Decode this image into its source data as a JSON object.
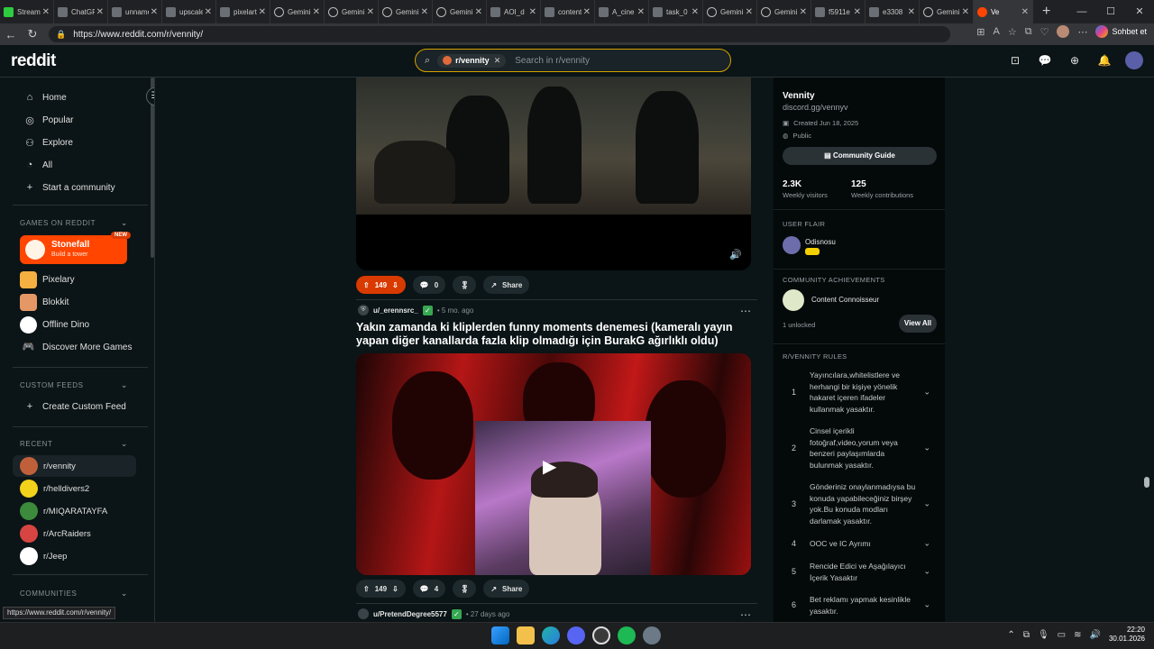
{
  "browser": {
    "tabs": [
      {
        "label": "Stream"
      },
      {
        "label": "ChatGPT"
      },
      {
        "label": "unname"
      },
      {
        "label": "upscale"
      },
      {
        "label": "pixelart"
      },
      {
        "label": "Gemini"
      },
      {
        "label": "Gemini"
      },
      {
        "label": "Gemini"
      },
      {
        "label": "Gemini"
      },
      {
        "label": "AOI_d"
      },
      {
        "label": "content"
      },
      {
        "label": "A_cine"
      },
      {
        "label": "task_0"
      },
      {
        "label": "Gemini"
      },
      {
        "label": "Gemini"
      },
      {
        "label": "f5911e"
      },
      {
        "label": "e3308"
      },
      {
        "label": "Gemini"
      },
      {
        "label": "Ve"
      }
    ],
    "url": "https://www.reddit.com/r/vennity/",
    "copilot_label": "Sohbet et"
  },
  "header": {
    "logo": "reddit",
    "search_chip": "r/vennity",
    "search_placeholder": "Search in r/vennity"
  },
  "left_sidebar": {
    "nav": [
      {
        "label": "Home",
        "icon": "home-icon",
        "glyph": "⌂"
      },
      {
        "label": "Popular",
        "icon": "popular-icon",
        "glyph": "◎"
      },
      {
        "label": "Explore",
        "icon": "explore-icon",
        "glyph": "⚇"
      },
      {
        "label": "All",
        "icon": "all-icon",
        "glyph": "◔"
      },
      {
        "label": "Start a community",
        "icon": "plus-icon",
        "glyph": "+"
      }
    ],
    "games_header": "GAMES ON REDDIT",
    "featured_game": {
      "title": "Stonefall",
      "subtitle": "Build a tower",
      "badge": "NEW"
    },
    "games": [
      {
        "label": "Pixelary",
        "color": "#f5b041"
      },
      {
        "label": "Blokkit",
        "color": "#e59866"
      },
      {
        "label": "Offline Dino",
        "color": "#ffffff"
      },
      {
        "label": "Discover More Games",
        "color": "#0b1416"
      }
    ],
    "custom_feeds_header": "CUSTOM FEEDS",
    "create_custom_feed": "Create Custom Feed",
    "recent_header": "RECENT",
    "recent": [
      {
        "label": "r/vennity",
        "color": "#c0603a"
      },
      {
        "label": "r/helldivers2",
        "color": "#f2d21b"
      },
      {
        "label": "r/MIQARATAYFA",
        "color": "#3c8a3c"
      },
      {
        "label": "r/ArcRaiders",
        "color": "#d64541"
      },
      {
        "label": "r/Jeep",
        "color": "#ffffff"
      }
    ],
    "communities_header": "COMMUNITIES"
  },
  "feed": {
    "post1_actions": {
      "upvotes": "149",
      "comments": "0",
      "share": "Share"
    },
    "post2": {
      "author": "u/_erennsrc_",
      "time": "• 5 mo. ago",
      "title": "Yakın zamanda ki kliplerden funny moments denemesi (kameralı yayın yapan diğer kanallarda fazla klip olmadığı için BurakG ağırlıklı oldu)",
      "upvotes": "149",
      "comments": "4",
      "share": "Share"
    },
    "post3": {
      "author": "u/PretendDegree5577",
      "time": "• 27 days ago"
    }
  },
  "right_sidebar": {
    "name": "Vennity",
    "link": "discord.gg/vennyv",
    "created": "Created Jun 18, 2025",
    "visibility": "Public",
    "guide_button": "Community Guide",
    "stats": [
      {
        "value": "2.3K",
        "label": "Weekly visitors"
      },
      {
        "value": "125",
        "label": "Weekly contributions"
      }
    ],
    "user_flair_header": "USER FLAIR",
    "flair_name": "Odisnosu",
    "achievements_header": "COMMUNITY ACHIEVEMENTS",
    "achievement": "Content Connoisseur",
    "unlocked": "1 unlocked",
    "view_all": "View All",
    "rules_header": "R/VENNITY RULES",
    "rules": [
      {
        "num": "1",
        "text": "Yayıncılara,whitelistlere ve herhangi bir kişiye yönelik hakaret içeren ifadeler kullanmak yasaktır."
      },
      {
        "num": "2",
        "text": "Cinsel içerikli fotoğraf,video,yorum veya benzeri paylaşımlarda bulunmak yasaktır."
      },
      {
        "num": "3",
        "text": "Gönderiniz onaylanmadıysa bu konuda yapabileceğiniz birşey yok.Bu konuda modları darlamak yasaktır."
      },
      {
        "num": "4",
        "text": "OOC ve IC Ayrımı"
      },
      {
        "num": "5",
        "text": "Rencide Edici ve Aşağılayıcı İçerik Yasaktır"
      },
      {
        "num": "6",
        "text": "Bet reklamı yapmak kesinlikle yasaktır."
      }
    ]
  },
  "status_url": "https://www.reddit.com/r/vennity/",
  "clock": {
    "time": "22:20",
    "date": "30.01.2026"
  }
}
